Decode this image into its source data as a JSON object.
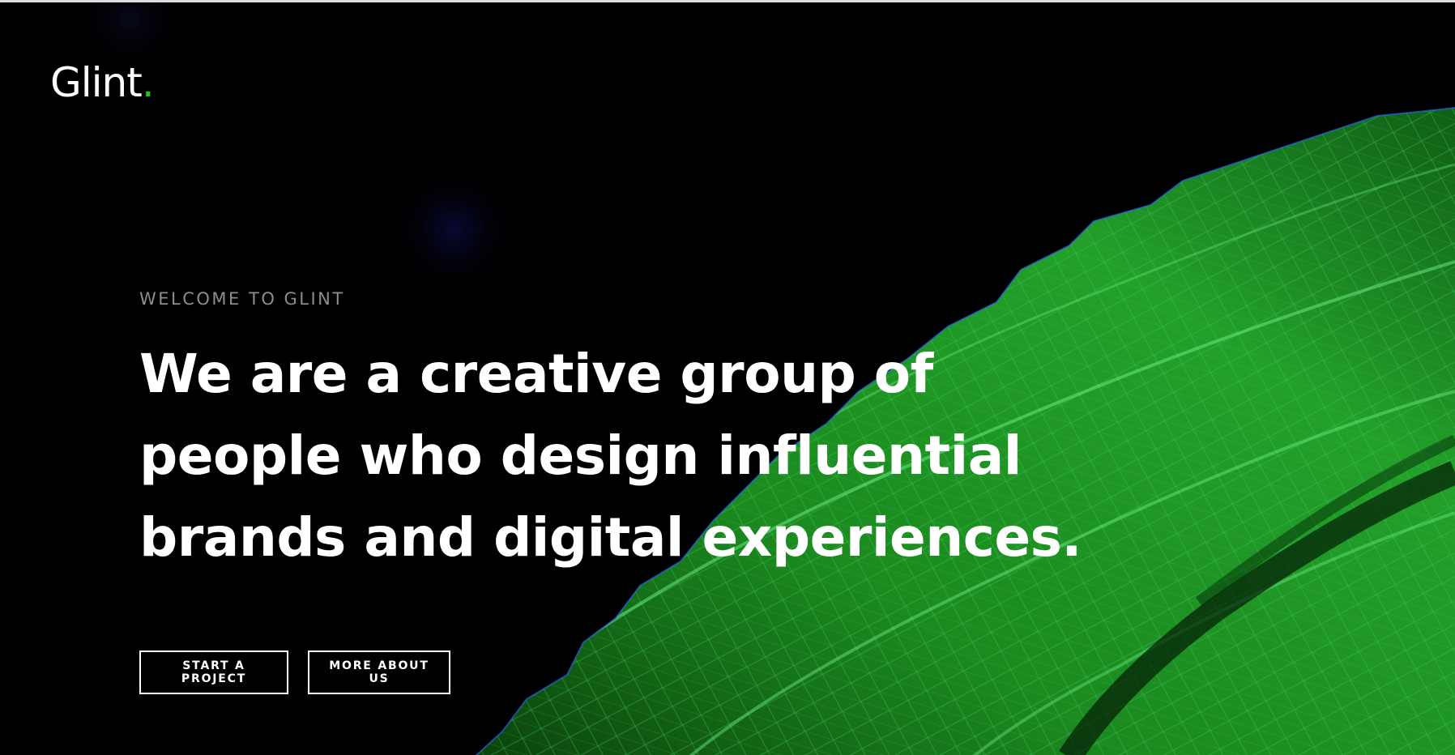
{
  "brand": {
    "name": "Glint",
    "dot": ".",
    "accent_color": "#22c31a"
  },
  "hero": {
    "eyebrow": "WELCOME TO GLINT",
    "headline_lines": [
      "We are a creative group of",
      "people who design influential",
      "brands and digital experiences."
    ],
    "background": "green-leaf-macro-image"
  },
  "actions": {
    "primary_label": "START A PROJECT",
    "secondary_label": "MORE ABOUT US"
  }
}
